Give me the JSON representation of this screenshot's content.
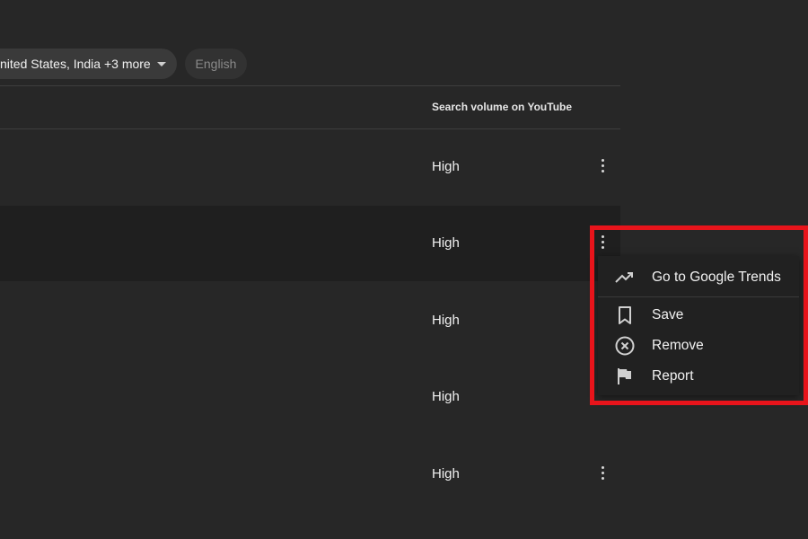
{
  "filters": {
    "region_chip": "nited States, India +3 more",
    "language_chip": "English"
  },
  "table": {
    "column_header": "Search volume on YouTube",
    "rows": [
      {
        "volume": "High"
      },
      {
        "volume": "High"
      },
      {
        "volume": "High"
      },
      {
        "volume": "High"
      },
      {
        "volume": "High"
      }
    ]
  },
  "context_menu": {
    "items": [
      {
        "label": "Go to Google Trends",
        "icon": "trending-up-icon"
      },
      {
        "label": "Save",
        "icon": "bookmark-icon"
      },
      {
        "label": "Remove",
        "icon": "remove-circle-icon"
      },
      {
        "label": "Report",
        "icon": "flag-icon"
      }
    ]
  },
  "colors": {
    "background": "#272727",
    "selected_row": "#1f1f1f",
    "menu_background": "#212121",
    "highlight_border": "#e8141b"
  }
}
